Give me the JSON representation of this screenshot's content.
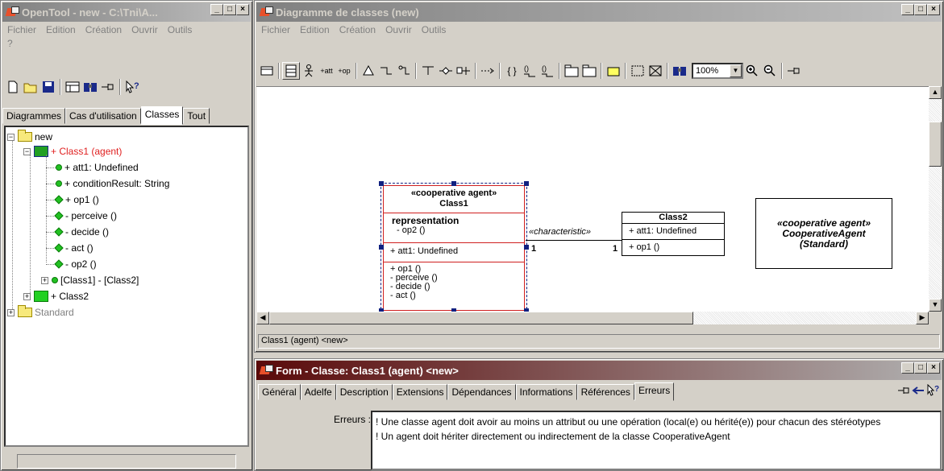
{
  "left_window": {
    "title": "OpenTool - new - C:\\Tni\\A...",
    "menu": [
      "Fichier",
      "Edition",
      "Création",
      "Ouvrir",
      "Outils",
      "?"
    ],
    "tabs": [
      "Diagrammes",
      "Cas d'utilisation",
      "Classes",
      "Tout"
    ],
    "selected_tab": "Classes",
    "tree": [
      {
        "label": "new"
      },
      {
        "label": "+ Class1 (agent)"
      },
      {
        "label": "+ att1: Undefined"
      },
      {
        "label": "+ conditionResult: String"
      },
      {
        "label": "+ op1 ()"
      },
      {
        "label": "- perceive ()"
      },
      {
        "label": "- decide ()"
      },
      {
        "label": "- act ()"
      },
      {
        "label": "- op2 ()"
      },
      {
        "label": "[Class1] - [Class2]"
      },
      {
        "label": "+ Class2"
      },
      {
        "label": "Standard"
      }
    ]
  },
  "diagram_window": {
    "title": "Diagramme de classes (new)",
    "menu": [
      "Fichier",
      "Edition",
      "Création",
      "Ouvrir",
      "Outils"
    ],
    "zoom": "100%",
    "toolbar_labels": {
      "att": "+att",
      "op": "+op"
    },
    "class1": {
      "stereotype": "«cooperative agent»",
      "name": "Class1",
      "section_title": "representation",
      "section_ops": [
        "- op2 ()"
      ],
      "attributes": [
        "+ att1: Undefined"
      ],
      "operations": [
        "+ op1 ()",
        "- perceive ()",
        "- decide ()",
        "- act ()"
      ]
    },
    "association": {
      "label": "«characteristic»",
      "mult_left": "1",
      "mult_right": "1"
    },
    "class2": {
      "name": "Class2",
      "attributes": [
        "+ att1: Undefined"
      ],
      "operations": [
        "+ op1 ()"
      ]
    },
    "note": {
      "stereotype": "«cooperative agent»",
      "name": "CooperativeAgent",
      "package": "(Standard)"
    },
    "status": "Class1 (agent) <new>"
  },
  "form_window": {
    "title": "Form - Classe: Class1 (agent) <new>",
    "tabs": [
      "Général",
      "Adelfe",
      "Description",
      "Extensions",
      "Dépendances",
      "Informations",
      "Références",
      "Erreurs"
    ],
    "selected_tab": "Erreurs",
    "errors_label": "Erreurs :",
    "errors": [
      "! Une classe agent doit avoir au moins un attribut ou une opération (local(e) ou hérité(e)) pour chacun des stéréotypes",
      "! Un agent doit hériter directement ou indirectement de la classe CooperativeAgent"
    ]
  },
  "colors": {
    "selected_text": "#e02020",
    "active_title": "#5a0a0a",
    "disabled_text": "#808080"
  }
}
